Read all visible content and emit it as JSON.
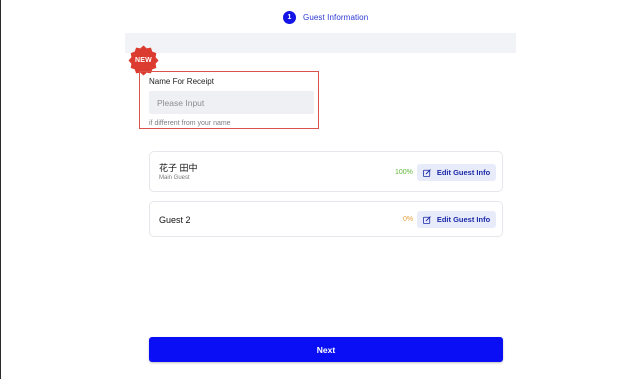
{
  "stepper": {
    "step_number": "1",
    "step_label": "Guest Information"
  },
  "badge": {
    "label": "NEW",
    "color": "#dc3b2f"
  },
  "receipt": {
    "label": "Name For Receipt",
    "placeholder": "Please Input",
    "value": "",
    "hint": "if different from your name"
  },
  "guests": [
    {
      "name": "花子 田中",
      "role": "Main Guest",
      "progress": "100%",
      "edit_label": "Edit Guest Info"
    },
    {
      "name": "Guest 2",
      "progress": "0%",
      "edit_label": "Edit Guest Info"
    }
  ],
  "next_label": "Next",
  "colors": {
    "accent": "#0a0ef5",
    "highlight_border": "#d9534a",
    "complete": "#5fb836",
    "incomplete": "#e8a23a"
  }
}
